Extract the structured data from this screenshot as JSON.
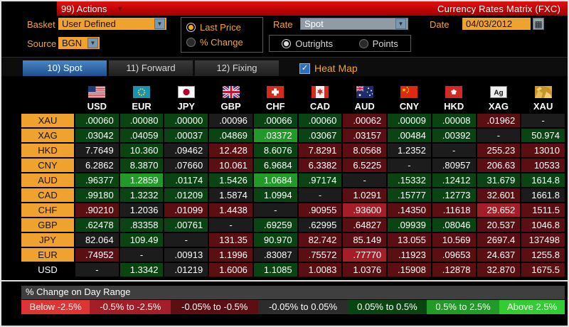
{
  "titlebar": {
    "actions_label": "99) Actions",
    "title": "Currency Rates Matrix (FXC)"
  },
  "controls": {
    "basket_label": "Basket",
    "basket_value": "User Defined",
    "source_label": "Source",
    "source_value": "BGN",
    "price_mode": {
      "options": [
        "Last Price",
        "% Change"
      ],
      "selected": "Last Price"
    },
    "rate_label": "Rate",
    "rate_value": "Spot",
    "rate_mode": {
      "options": [
        "Outrights",
        "Points"
      ],
      "selected": "Outrights"
    },
    "date_label": "Date",
    "date_value": "04/03/2012"
  },
  "tabs": [
    {
      "label": "10) Spot",
      "selected": true
    },
    {
      "label": "11) Forward",
      "selected": false
    },
    {
      "label": "12) Fixing",
      "selected": false
    }
  ],
  "heatmap_checkbox": {
    "label": "Heat Map",
    "checked": true
  },
  "heat_colors": {
    "g1": "#0b4413",
    "g2": "#219a28",
    "k": "#1c1c1c",
    "r1": "#5c0f13",
    "r2": "#a51e27"
  },
  "matrix": {
    "columns": [
      {
        "code": "USD",
        "icon": "us-flag-icon"
      },
      {
        "code": "EUR",
        "icon": "eu-flag-icon"
      },
      {
        "code": "JPY",
        "icon": "japan-flag-icon"
      },
      {
        "code": "GBP",
        "icon": "uk-flag-icon"
      },
      {
        "code": "CHF",
        "icon": "switzerland-flag-icon"
      },
      {
        "code": "CAD",
        "icon": "canada-flag-icon"
      },
      {
        "code": "AUD",
        "icon": "australia-flag-icon"
      },
      {
        "code": "CNY",
        "icon": "china-flag-icon"
      },
      {
        "code": "HKD",
        "icon": "hong-kong-flag-icon"
      },
      {
        "code": "XAG",
        "icon": "silver-icon"
      },
      {
        "code": "XAU",
        "icon": "gold-icon"
      }
    ],
    "rows": [
      {
        "label": "XAU",
        "style": "chip",
        "cells": [
          {
            "v": ".00060",
            "c": "g1"
          },
          {
            "v": ".00080",
            "c": "g1"
          },
          {
            "v": ".00000",
            "c": "g1"
          },
          {
            "v": ".00096",
            "c": "k"
          },
          {
            "v": ".00066",
            "c": "g1"
          },
          {
            "v": ".00060",
            "c": "g1"
          },
          {
            "v": ".00062",
            "c": "r1"
          },
          {
            "v": ".00009",
            "c": "g1"
          },
          {
            "v": ".00008",
            "c": "g1"
          },
          {
            "v": ".01962",
            "c": "r1"
          },
          {
            "v": "-",
            "c": "k"
          }
        ]
      },
      {
        "label": "XAG",
        "style": "chip",
        "cells": [
          {
            "v": ".03042",
            "c": "g1"
          },
          {
            "v": ".04059",
            "c": "g1"
          },
          {
            "v": ".00037",
            "c": "g1"
          },
          {
            "v": ".04869",
            "c": "g1"
          },
          {
            "v": ".03372",
            "c": "g2"
          },
          {
            "v": ".03067",
            "c": "g1"
          },
          {
            "v": ".03157",
            "c": "r1"
          },
          {
            "v": ".00484",
            "c": "g1"
          },
          {
            "v": ".00392",
            "c": "g1"
          },
          {
            "v": "-",
            "c": "k"
          },
          {
            "v": "50.974",
            "c": "g1"
          }
        ]
      },
      {
        "label": "HKD",
        "style": "chip",
        "cells": [
          {
            "v": "7.7649",
            "c": "k"
          },
          {
            "v": "10.360",
            "c": "g1"
          },
          {
            "v": ".09462",
            "c": "k"
          },
          {
            "v": "12.428",
            "c": "r1"
          },
          {
            "v": "8.6076",
            "c": "g1"
          },
          {
            "v": "7.8291",
            "c": "r1"
          },
          {
            "v": "8.0568",
            "c": "r1"
          },
          {
            "v": "1.2352",
            "c": "k"
          },
          {
            "v": "-",
            "c": "k"
          },
          {
            "v": "255.23",
            "c": "r1"
          },
          {
            "v": "13010",
            "c": "r1"
          }
        ]
      },
      {
        "label": "CNY",
        "style": "chip",
        "cells": [
          {
            "v": "6.2862",
            "c": "k"
          },
          {
            "v": "8.3870",
            "c": "g1"
          },
          {
            "v": ".07660",
            "c": "k"
          },
          {
            "v": "10.061",
            "c": "r1"
          },
          {
            "v": "6.9684",
            "c": "g1"
          },
          {
            "v": "6.3382",
            "c": "r1"
          },
          {
            "v": "6.5225",
            "c": "r1"
          },
          {
            "v": "-",
            "c": "k"
          },
          {
            "v": ".80957",
            "c": "k"
          },
          {
            "v": "206.63",
            "c": "r1"
          },
          {
            "v": "10533",
            "c": "r1"
          }
        ]
      },
      {
        "label": "AUD",
        "style": "chip",
        "cells": [
          {
            "v": ".96377",
            "c": "g1"
          },
          {
            "v": "1.2859",
            "c": "g2"
          },
          {
            "v": ".01174",
            "c": "g1"
          },
          {
            "v": "1.5426",
            "c": "g1"
          },
          {
            "v": "1.0684",
            "c": "g2"
          },
          {
            "v": ".97174",
            "c": "g1"
          },
          {
            "v": "-",
            "c": "k"
          },
          {
            "v": ".15332",
            "c": "g1"
          },
          {
            "v": ".12412",
            "c": "g1"
          },
          {
            "v": "31.679",
            "c": "g1"
          },
          {
            "v": "1614.8",
            "c": "g1"
          }
        ]
      },
      {
        "label": "CAD",
        "style": "chip",
        "cells": [
          {
            "v": ".99180",
            "c": "g1"
          },
          {
            "v": "1.3232",
            "c": "g1"
          },
          {
            "v": ".01209",
            "c": "g1"
          },
          {
            "v": "1.5874",
            "c": "k"
          },
          {
            "v": "1.0994",
            "c": "g1"
          },
          {
            "v": "-",
            "c": "k"
          },
          {
            "v": "1.0291",
            "c": "r1"
          },
          {
            "v": ".15777",
            "c": "g1"
          },
          {
            "v": ".12773",
            "c": "g1"
          },
          {
            "v": "32.601",
            "c": "r1"
          },
          {
            "v": "1661.8",
            "c": "k"
          }
        ]
      },
      {
        "label": "CHF",
        "style": "chip",
        "cells": [
          {
            "v": ".90210",
            "c": "r1"
          },
          {
            "v": "1.2036",
            "c": "k"
          },
          {
            "v": ".01099",
            "c": "r1"
          },
          {
            "v": "1.4438",
            "c": "r1"
          },
          {
            "v": "-",
            "c": "k"
          },
          {
            "v": ".90955",
            "c": "r1"
          },
          {
            "v": ".93600",
            "c": "r2"
          },
          {
            "v": ".14350",
            "c": "r1"
          },
          {
            "v": ".11618",
            "c": "r1"
          },
          {
            "v": "29.652",
            "c": "r2"
          },
          {
            "v": "1511.5",
            "c": "r1"
          }
        ]
      },
      {
        "label": "GBP",
        "style": "chip",
        "cells": [
          {
            "v": ".62478",
            "c": "g1"
          },
          {
            "v": ".83358",
            "c": "g1"
          },
          {
            "v": ".00761",
            "c": "g1"
          },
          {
            "v": "-",
            "c": "k"
          },
          {
            "v": ".69259",
            "c": "g1"
          },
          {
            "v": ".62995",
            "c": "k"
          },
          {
            "v": ".64827",
            "c": "r1"
          },
          {
            "v": ".09939",
            "c": "g1"
          },
          {
            "v": ".08046",
            "c": "g1"
          },
          {
            "v": "20.537",
            "c": "r1"
          },
          {
            "v": "1046.8",
            "c": "r1"
          }
        ]
      },
      {
        "label": "JPY",
        "style": "chip",
        "cells": [
          {
            "v": "82.064",
            "c": "k"
          },
          {
            "v": "109.49",
            "c": "g1"
          },
          {
            "v": "-",
            "c": "k"
          },
          {
            "v": "131.35",
            "c": "r1"
          },
          {
            "v": "90.970",
            "c": "g1"
          },
          {
            "v": "82.742",
            "c": "r1"
          },
          {
            "v": "85.149",
            "c": "r1"
          },
          {
            "v": "13.055",
            "c": "r1"
          },
          {
            "v": "10.569",
            "c": "r1"
          },
          {
            "v": "2697.4",
            "c": "r1"
          },
          {
            "v": "137498",
            "c": "r1"
          }
        ]
      },
      {
        "label": "EUR",
        "style": "chip",
        "cells": [
          {
            "v": ".74952",
            "c": "r1"
          },
          {
            "v": "-",
            "c": "k"
          },
          {
            "v": ".00913",
            "c": "k"
          },
          {
            "v": "1.1996",
            "c": "r1"
          },
          {
            "v": ".83087",
            "c": "k"
          },
          {
            "v": ".75572",
            "c": "r1"
          },
          {
            "v": ".77770",
            "c": "r2"
          },
          {
            "v": ".11923",
            "c": "r1"
          },
          {
            "v": ".09653",
            "c": "r1"
          },
          {
            "v": "24.637",
            "c": "r1"
          },
          {
            "v": "1255.8",
            "c": "r1"
          }
        ]
      },
      {
        "label": "USD",
        "style": "plain",
        "cells": [
          {
            "v": "-",
            "c": "k"
          },
          {
            "v": "1.3342",
            "c": "g1"
          },
          {
            "v": ".01219",
            "c": "k"
          },
          {
            "v": "1.6006",
            "c": "r1"
          },
          {
            "v": "1.1085",
            "c": "g1"
          },
          {
            "v": "1.0083",
            "c": "r1"
          },
          {
            "v": "1.0376",
            "c": "r1"
          },
          {
            "v": ".15908",
            "c": "r1"
          },
          {
            "v": ".12878",
            "c": "r1"
          },
          {
            "v": "32.870",
            "c": "r1"
          },
          {
            "v": "1675.5",
            "c": "r1"
          }
        ]
      }
    ]
  },
  "legend": {
    "title": "% Change on Day Range",
    "buckets": [
      {
        "label": "Below -2.5%",
        "color": "#dd3434"
      },
      {
        "label": "-0.5% to -2.5%",
        "color": "#a51e27"
      },
      {
        "label": "-0.05% to -0.5%",
        "color": "#5c0f13"
      },
      {
        "label": "-0.05% to 0.05%",
        "color": "#2c2c2c"
      },
      {
        "label": "0.05% to 0.5%",
        "color": "#0b4413"
      },
      {
        "label": "0.5% to 2.5%",
        "color": "#219a28"
      },
      {
        "label": "Above 2.5%",
        "color": "#33cc33"
      }
    ]
  }
}
